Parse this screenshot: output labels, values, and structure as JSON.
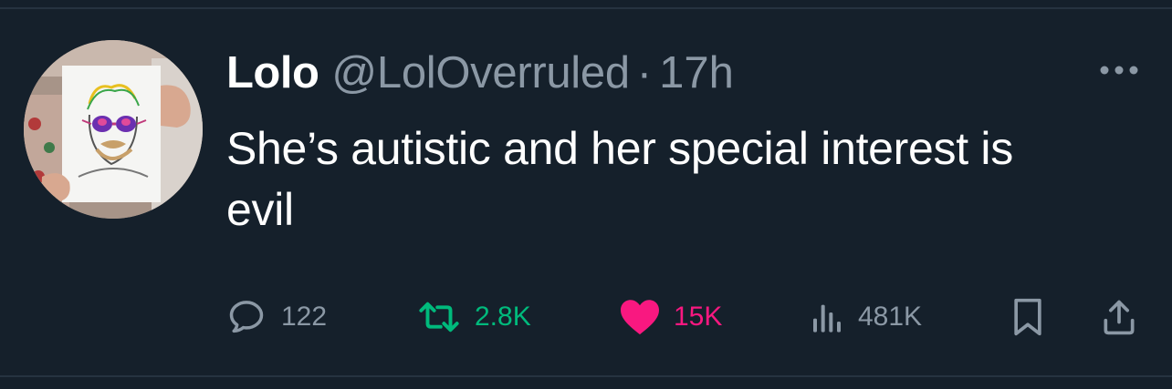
{
  "tweet": {
    "author": {
      "name": "Lolo",
      "handle": "@LolOverruled",
      "separator": "·",
      "time": "17h"
    },
    "text": "She’s autistic and her special interest is evil",
    "stats": {
      "replies": "122",
      "retweets": "2.8K",
      "likes": "15K",
      "views": "481K"
    }
  },
  "icons": {
    "reply": "speech-bubble-icon",
    "retweet": "retweet-arrows-icon",
    "like": "heart-icon-filled",
    "views": "bar-chart-icon",
    "bookmark": "bookmark-icon",
    "share": "share-upload-icon",
    "more": "more-horizontal-icon"
  },
  "colors": {
    "background": "#15202b",
    "secondary_text": "#8b98a5",
    "retweet_active": "#00ba7c",
    "like_active": "#f91880"
  }
}
